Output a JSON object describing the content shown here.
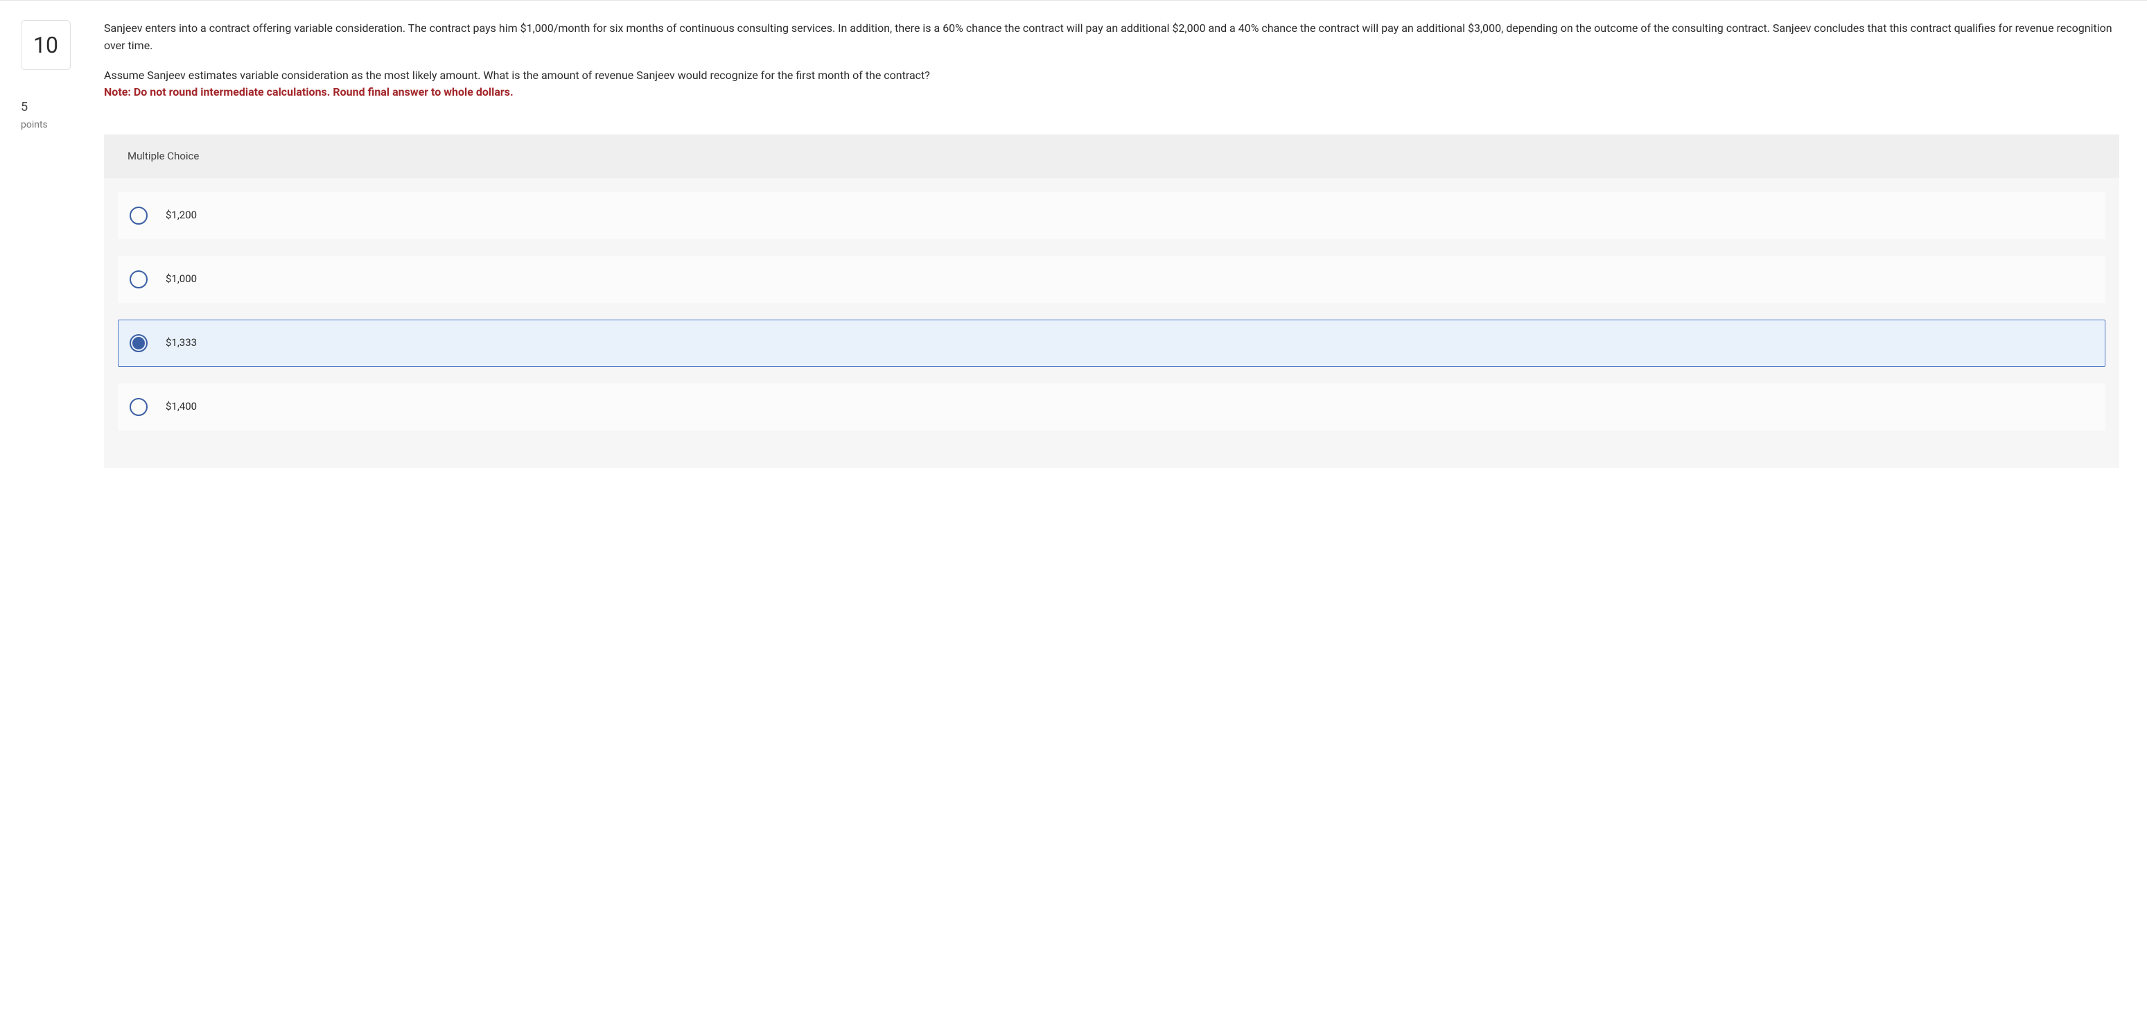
{
  "question": {
    "number": "10",
    "points_value": "5",
    "points_label": "points",
    "paragraph1": "Sanjeev enters into a contract offering variable consideration. The contract pays him $1,000/month for six months of continuous consulting services. In addition, there is a 60% chance the contract will pay an additional $2,000 and a 40% chance the contract will pay an additional $3,000, depending on the outcome of the consulting contract. Sanjeev concludes that this contract qualifies for revenue recognition over time.",
    "paragraph2_lead": "Assume Sanjeev estimates variable consideration as the most likely amount. What is the amount of revenue Sanjeev would recognize for the first month of the contract?",
    "note": "Note: Do not round intermediate calculations. Round final answer to whole dollars."
  },
  "answer": {
    "type_label": "Multiple Choice",
    "options": [
      {
        "label": "$1,200",
        "selected": false
      },
      {
        "label": "$1,000",
        "selected": false
      },
      {
        "label": "$1,333",
        "selected": true
      },
      {
        "label": "$1,400",
        "selected": false
      }
    ]
  }
}
